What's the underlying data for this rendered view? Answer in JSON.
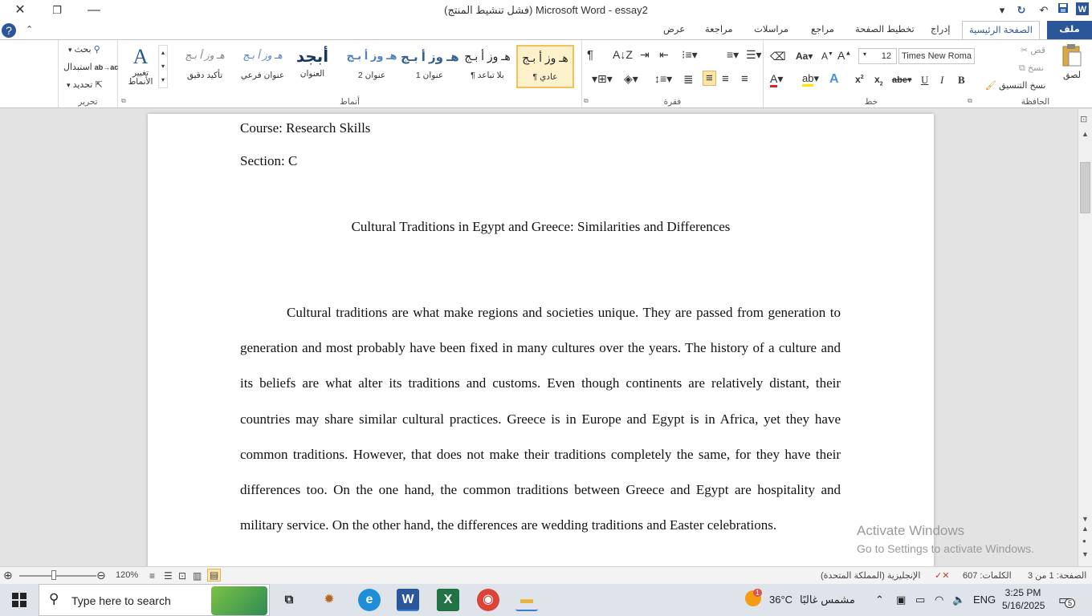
{
  "titlebar": {
    "title": "(فشل تنشيط المنتج) Microsoft Word  -  essay2",
    "close": "✕",
    "restore": "❐",
    "minimize": "—"
  },
  "tabs": {
    "file": "ملف",
    "home": "الصفحة الرئيسية",
    "insert": "إدراج",
    "layout": "تخطيط الصفحة",
    "references": "مراجع",
    "mailings": "مراسلات",
    "review": "مراجعة",
    "view": "عرض"
  },
  "clipboard": {
    "paste": "لصق",
    "cut": "قص",
    "copy": "نسخ",
    "format_painter": "نسخ التنسيق",
    "label": "الحافظة"
  },
  "font": {
    "name": "Times New Roma",
    "size": "12",
    "label": "خط"
  },
  "paragraph": {
    "label": "فقرة"
  },
  "styles": {
    "label": "أنماط",
    "items": [
      {
        "preview": "هـ وز أ بـج",
        "label": "¶ عادي"
      },
      {
        "preview": "هـ وز أ بـج",
        "label": "¶ بلا تباعد"
      },
      {
        "preview": "هـ وز أ بـج",
        "label": "عنوان 1"
      },
      {
        "preview": "هـ وز أ بـج",
        "label": "عنوان 2"
      },
      {
        "preview": "أبجد",
        "label": "العنوان"
      },
      {
        "preview": "هـ وز أ بـج",
        "label": "عنوان فرعي"
      },
      {
        "preview": "هـ وز أ بـج",
        "label": "تأكيد دقيق"
      }
    ],
    "change_styles": "تغيير الأنماط"
  },
  "editing": {
    "find": "بحث",
    "replace": "استبدال",
    "select": "تحديد",
    "label": "تحرير"
  },
  "document": {
    "course": "Course: Research Skills",
    "section": "Section: C",
    "heading": "Cultural Traditions in Egypt and Greece: Similarities and Differences",
    "paragraph": "Cultural traditions are what make regions and societies unique. They are passed from generation to generation and most probably have been fixed in many cultures over the years. The history of a culture and its beliefs are what alter its traditions and customs. Even though continents are relatively distant, their countries may share similar cultural practices. Greece is in Europe and Egypt is in Africa, yet they have common traditions. However, that does not make their traditions completely the same, for they have their differences too. On the one hand, the common traditions between Greece and Egypt are hospitality and military service. On the other hand, the differences are wedding traditions and Easter celebrations."
  },
  "watermark": {
    "title": "Activate Windows",
    "subtitle": "Go to Settings to activate Windows."
  },
  "statusbar": {
    "page": "الصفحة: 1 من 3",
    "words": "الكلمات: 607",
    "language": "الإنجليزية (المملكة المتحدة)",
    "zoom": "120%"
  },
  "taskbar": {
    "search_placeholder": "Type here to search",
    "weather_temp": "36°C",
    "weather_desc": "مشمس غالبًا",
    "language": "ENG",
    "time": "3:25 PM",
    "date": "5/16/2025",
    "notification_count": "5",
    "weather_badge": "1"
  },
  "colors": {
    "word_blue": "#2b579a",
    "font_color_red": "#e02020",
    "highlight_yellow": "#ffe600"
  }
}
